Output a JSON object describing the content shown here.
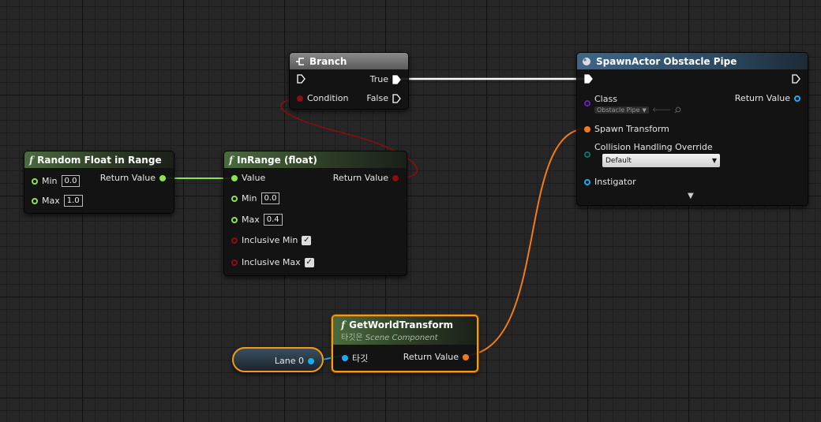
{
  "nodes": {
    "random_float": {
      "title": "Random Float in Range",
      "min_label": "Min",
      "min_value": "0.0",
      "max_label": "Max",
      "max_value": "1.0",
      "return_label": "Return Value"
    },
    "inrange": {
      "title": "InRange (float)",
      "value_label": "Value",
      "return_label": "Return Value",
      "min_label": "Min",
      "min_value": "0.0",
      "max_label": "Max",
      "max_value": "0.4",
      "inclusive_min_label": "Inclusive Min",
      "inclusive_min_checked": true,
      "inclusive_max_label": "Inclusive Max",
      "inclusive_max_checked": true
    },
    "branch": {
      "title": "Branch",
      "true_label": "True",
      "condition_label": "Condition",
      "false_label": "False"
    },
    "spawn_actor": {
      "title": "SpawnActor Obstacle Pipe",
      "class_label": "Class",
      "class_value": "Obstacle Pipe",
      "return_label": "Return Value",
      "spawn_transform_label": "Spawn Transform",
      "collision_label": "Collision Handling Override",
      "collision_value": "Default",
      "instigator_label": "Instigator"
    },
    "get_world_transform": {
      "title": "GetWorldTransform",
      "subtitle_prefix": "타깃은",
      "subtitle_class": "Scene Component",
      "target_label": "타깃",
      "return_label": "Return Value"
    },
    "lane_var": {
      "label": "Lane 0"
    }
  },
  "colors": {
    "float_pin": "#8ce34f",
    "bool_pin": "#8a0e0e",
    "transform_pin": "#f07b1e",
    "object_pin": "#1faaf0",
    "class_pin": "#6a1fb0",
    "selection": "#f39c12"
  },
  "icons": {
    "function": "function-icon",
    "branch": "branch-icon",
    "spawn": "spawn-actor-icon",
    "expand": "chevron-down-icon"
  }
}
